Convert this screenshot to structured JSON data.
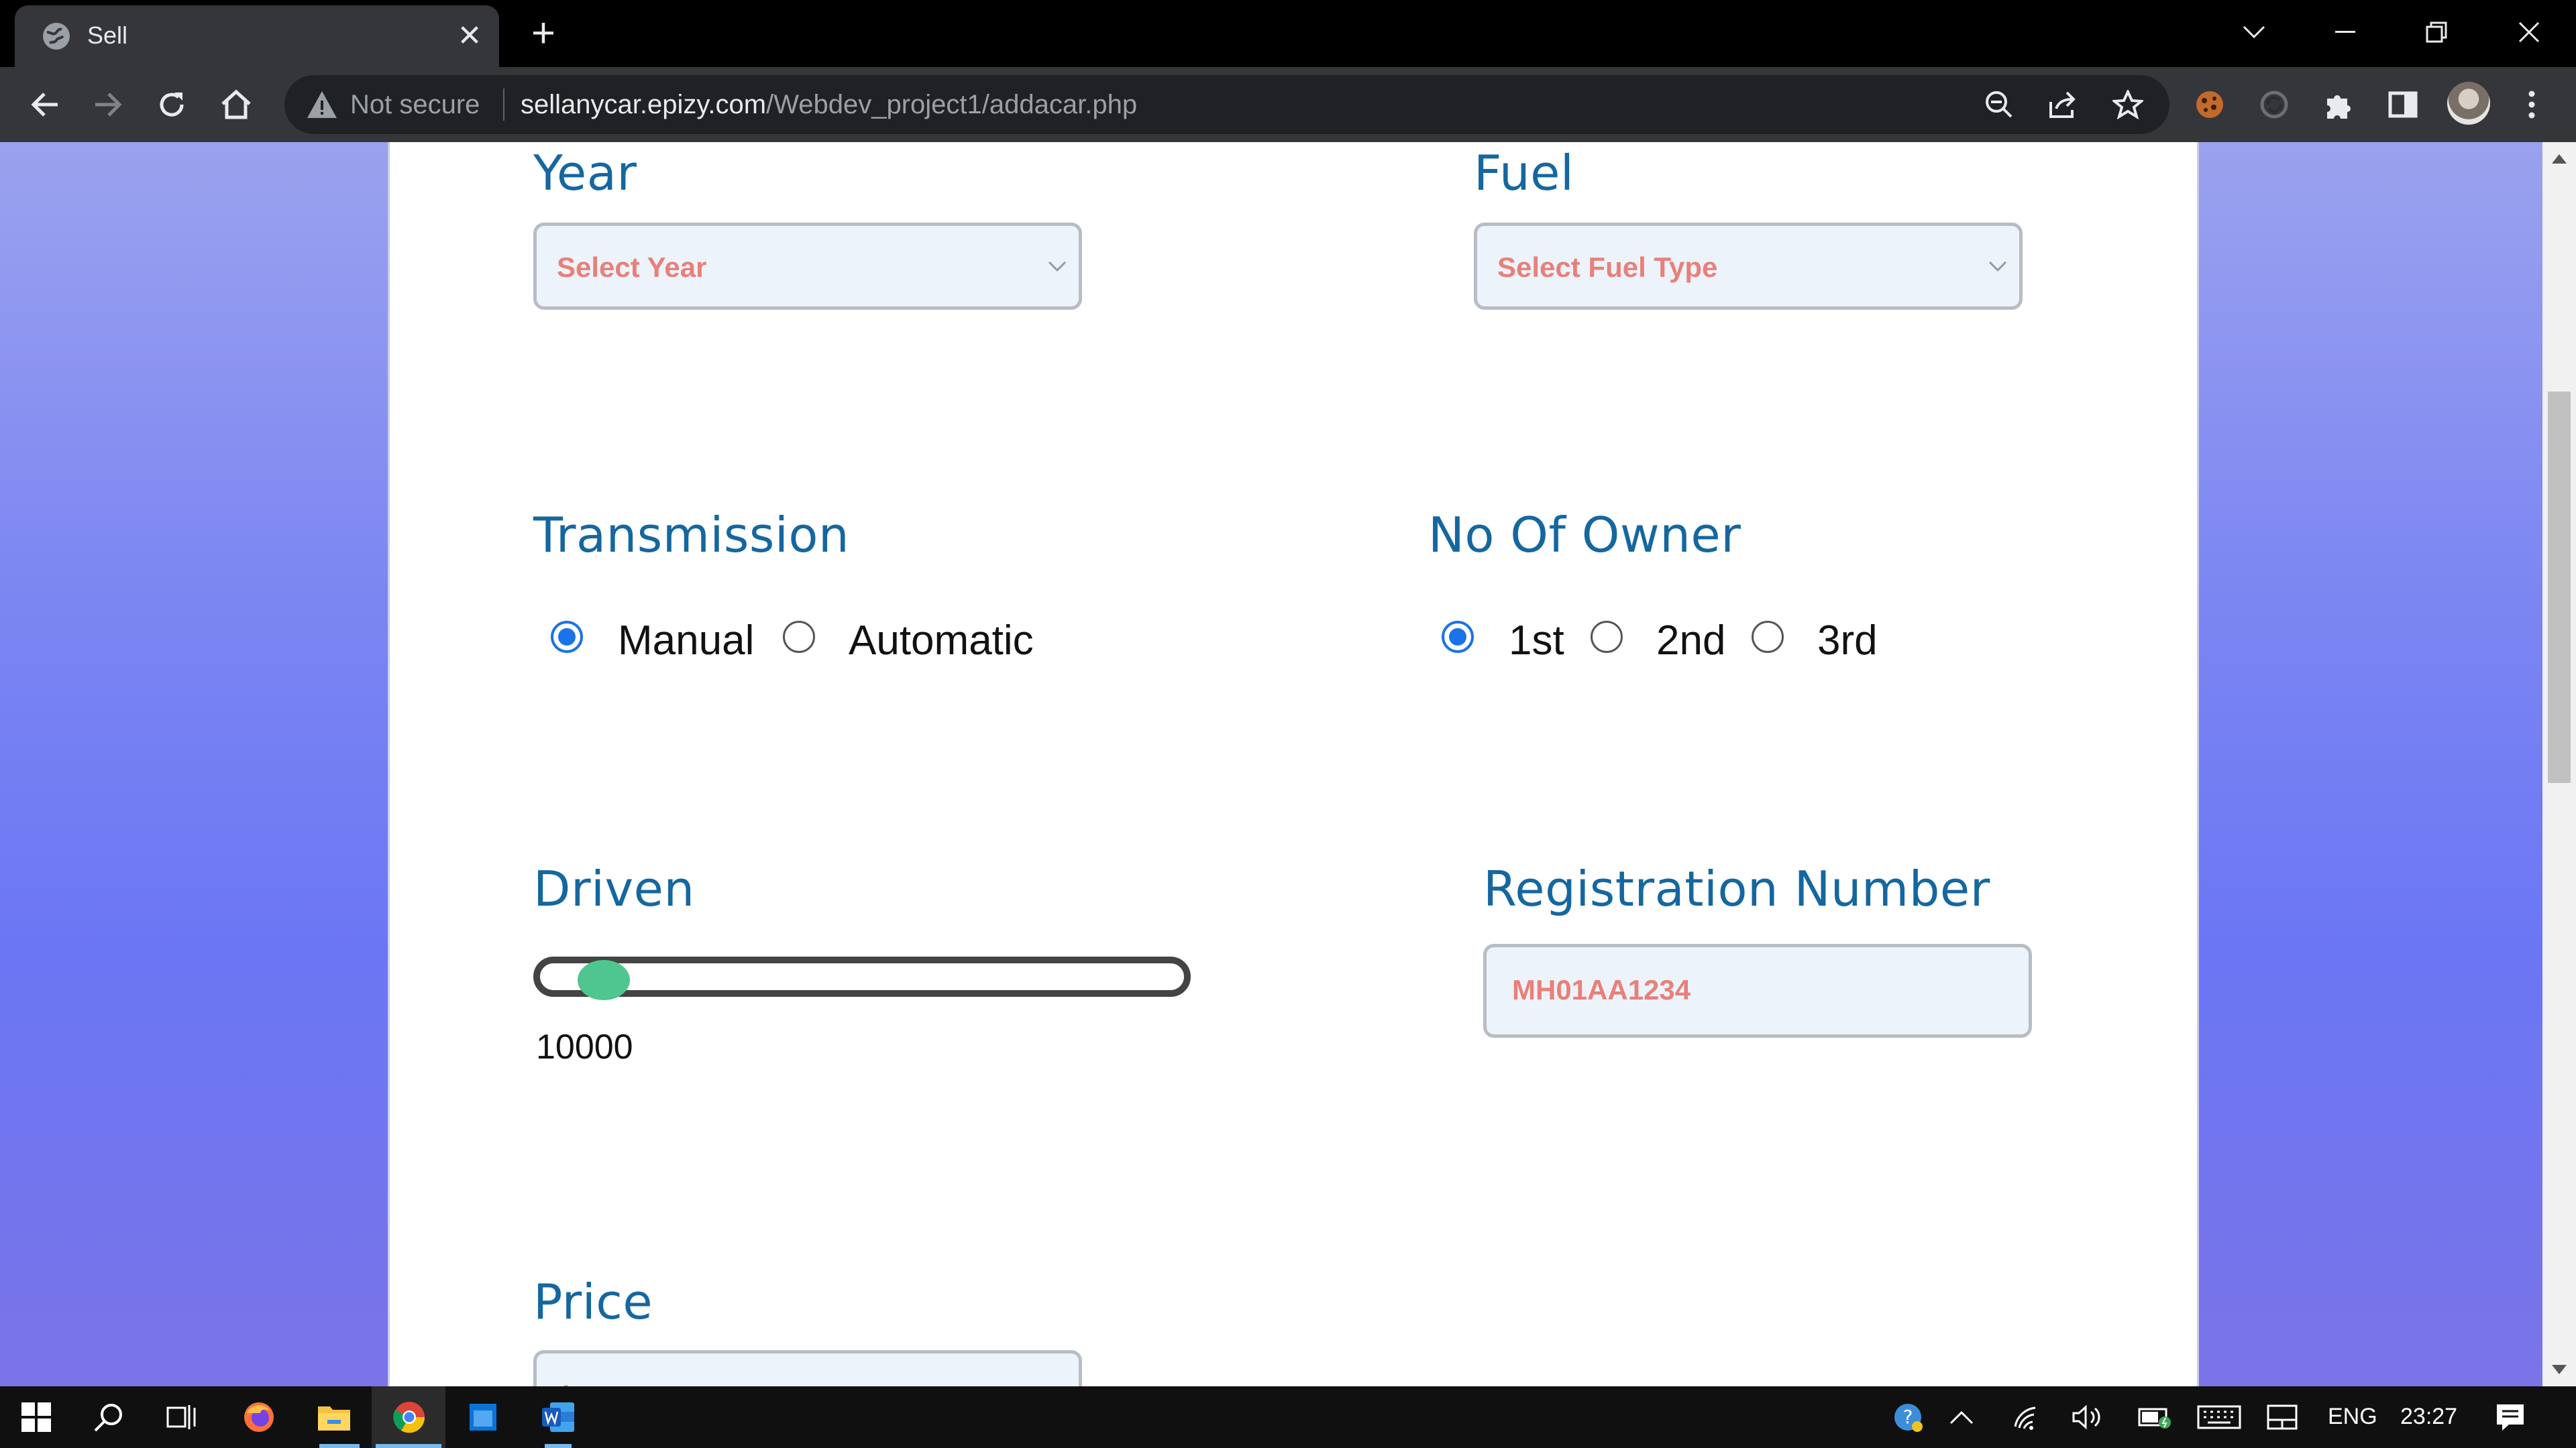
{
  "browser": {
    "tab_title": "Sell",
    "tab_close": "✕",
    "new_tab": "+",
    "security": "Not secure",
    "url_host": "sellanycar.epizy.com",
    "url_path": "/Webdev_project1/addacar.php"
  },
  "form": {
    "year": {
      "label": "Year",
      "placeholder": "Select Year"
    },
    "fuel": {
      "label": "Fuel",
      "placeholder": "Select Fuel Type"
    },
    "transmission": {
      "label": "Transmission",
      "options": [
        "Manual",
        "Automatic"
      ],
      "selected": "Manual"
    },
    "owners": {
      "label": "No Of Owner",
      "options": [
        "1st",
        "2nd",
        "3rd"
      ],
      "selected": "1st"
    },
    "driven": {
      "label": "Driven",
      "value": "10000",
      "slider_fraction": 0.1
    },
    "registration": {
      "label": "Registration Number",
      "placeholder": "MH01AA1234"
    },
    "price": {
      "label": "Price",
      "placeholder": "in Rupees"
    }
  },
  "taskbar": {
    "language": "ENG",
    "time": "23:27"
  },
  "colors": {
    "label": "#15679f",
    "placeholder": "#e8807a",
    "radio_checked": "#1a73e8",
    "slider_thumb": "#4fc58f"
  }
}
